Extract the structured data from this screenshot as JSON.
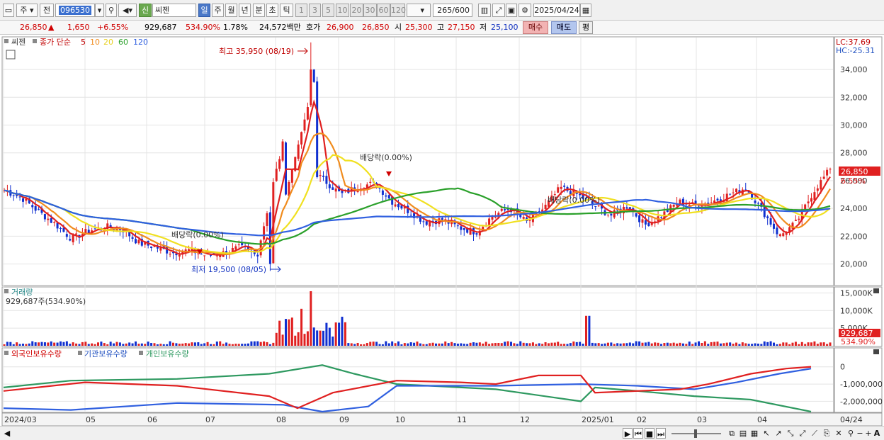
{
  "toolbar": {
    "mode": "주",
    "prev_label": "전",
    "code": "096530",
    "badge": "신",
    "name": "씨젠",
    "periods": [
      "일",
      "주",
      "월",
      "년",
      "분",
      "초",
      "틱"
    ],
    "intervals": [
      "1",
      "3",
      "5",
      "10",
      "20",
      "30",
      "60",
      "120"
    ],
    "count": "265",
    "count_total": "/600",
    "date": "2025/04/24"
  },
  "info": {
    "price": "26,850",
    "change_arrow": "▲",
    "change": "1,650",
    "change_pct": "+6.55%",
    "volume": "929,687",
    "volume_pct": "534.90%",
    "turnover_pct": "1.78%",
    "amount": "24,572백만",
    "quote_label": "호가",
    "ask": "26,900",
    "bid": "26,850",
    "open_label": "시",
    "open": "25,300",
    "high_label": "고",
    "high": "27,150",
    "low_label": "저",
    "low": "25,100",
    "buy_label": "매수",
    "sell_label": "매도",
    "avg_label": "평"
  },
  "legend": {
    "name": "씨젠",
    "ma_label": "종가 단순",
    "ma5": "5",
    "ma10": "10",
    "ma20": "20",
    "ma60": "60",
    "ma120": "120",
    "lc": "LC:37.69",
    "hc": "HC:-25.31"
  },
  "annotations": {
    "high": "최고 35,950 (08/19)",
    "low": "최저 19,500 (08/05)",
    "div1": "배당락(0.00%)",
    "div2": "배당락(0.00%)",
    "div3": "배당락(0.00%)",
    "last_price": "26,850",
    "last_pct": "6.55%"
  },
  "volume_panel": {
    "title": "거래량",
    "value": "929,687주(534.90%)",
    "last": "929,687",
    "last_pct": "534.90%"
  },
  "holdings_panel": {
    "series": [
      "외국인보유수량",
      "기관보유수량",
      "개인보유수량"
    ]
  },
  "colors": {
    "candle_up": "#e02020",
    "candle_down": "#1030d0",
    "ma5": "#e02020",
    "ma10": "#f08c1e",
    "ma20": "#f0e020",
    "ma60": "#2aa02a",
    "ma120": "#3060e0",
    "foreign": "#e02020",
    "institution": "#3060e0",
    "individual": "#2e9960"
  },
  "chart_data": [
    {
      "type": "candlestick",
      "title": "씨젠",
      "y_ticks": [
        "34,000",
        "32,000",
        "30,000",
        "28,000",
        "26,000",
        "24,000",
        "22,000",
        "20,000"
      ],
      "y_values": [
        34000,
        32000,
        30000,
        28000,
        26000,
        24000,
        22000,
        20000
      ],
      "ylim": [
        18500,
        36300
      ],
      "x_labels": [
        "2024/03",
        "05",
        "06",
        "07",
        "08",
        "09",
        "10",
        "11",
        "12",
        "2025/01",
        "02",
        "03",
        "04"
      ],
      "x_right_label": "04/24",
      "series": [
        {
          "name": "5",
          "type": "line"
        },
        {
          "name": "10",
          "type": "line"
        },
        {
          "name": "20",
          "type": "line"
        },
        {
          "name": "60",
          "type": "line"
        },
        {
          "name": "120",
          "type": "line"
        }
      ],
      "closes_approx": [
        25300,
        24800,
        23800,
        22900,
        21800,
        22400,
        22700,
        22500,
        21500,
        21200,
        20800,
        21000,
        20600,
        20800,
        21200,
        20600,
        26000,
        31000,
        27000,
        26000,
        25000,
        25600,
        25800,
        24500,
        23800,
        23000,
        23200,
        22600,
        22300,
        23500,
        24000,
        23000,
        24000,
        25500,
        25000,
        24200,
        23500,
        24200,
        22800,
        23500,
        24500,
        24200,
        24500,
        25000,
        25500,
        23800,
        22000,
        23000,
        25200,
        26850
      ]
    },
    {
      "type": "bar",
      "title": "거래량",
      "y_ticks": [
        "15,000K",
        "10,000K",
        "5,000K"
      ],
      "y_values": [
        15000,
        10000,
        5000
      ],
      "ylim": [
        0,
        16500
      ]
    },
    {
      "type": "line",
      "title": "",
      "y_ticks": [
        "0",
        "-1,000,000",
        "-2,000,000"
      ],
      "y_values": [
        0,
        -1000000,
        -2000000
      ],
      "series": [
        {
          "name": "외국인보유수량"
        },
        {
          "name": "기관보유수량"
        },
        {
          "name": "개인보유수량"
        }
      ]
    }
  ],
  "statusbar": {
    "btn_next": "▶",
    "zoom_in": "+",
    "font": "A"
  }
}
